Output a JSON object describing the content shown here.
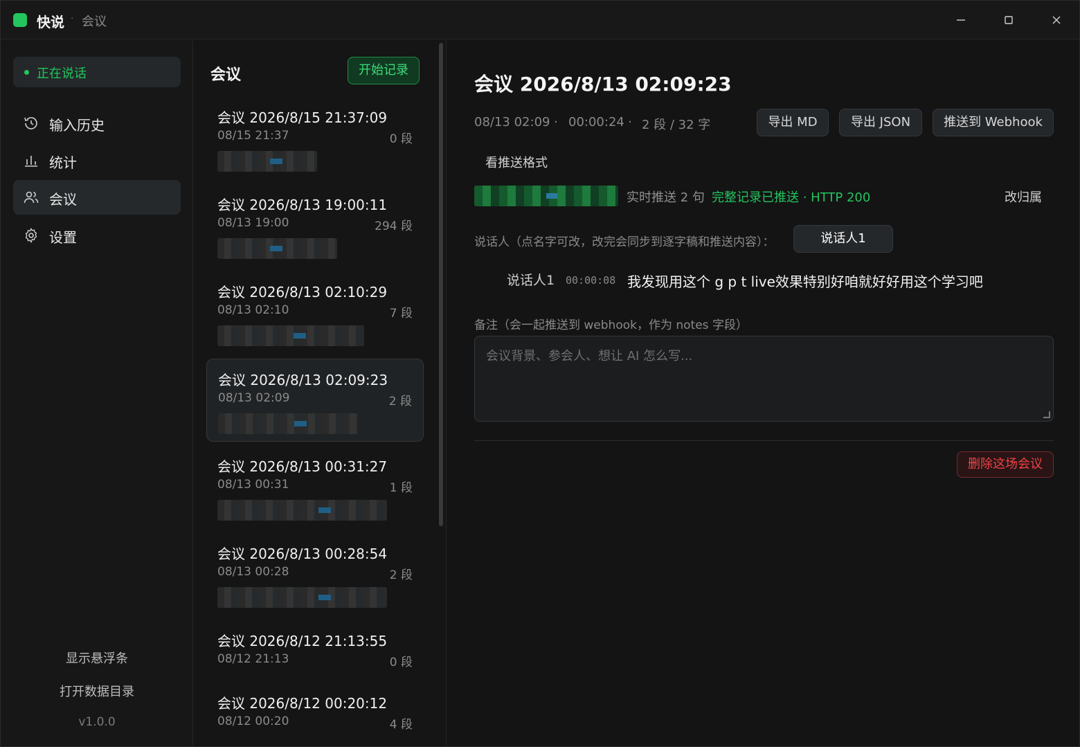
{
  "titlebar": {
    "app_name": "快说",
    "separator": "·",
    "section": "会议",
    "minimize_symbol": "—",
    "maximize_symbol": "☐",
    "close_symbol": "✕"
  },
  "sidebar": {
    "live_status": "正在说话",
    "items": [
      {
        "label": "输入历史",
        "icon": "history-icon"
      },
      {
        "label": "统计",
        "icon": "bar-chart-icon"
      },
      {
        "label": "会议",
        "icon": "users-icon",
        "active": true
      },
      {
        "label": "设置",
        "icon": "gear-icon"
      }
    ],
    "show_floating_bar": "显示悬浮条",
    "open_data_dir": "打开数据目录",
    "version": "v1.0.0"
  },
  "list": {
    "title": "会议",
    "start_button": "开始记录",
    "meetings": [
      {
        "title": "会议 2026/8/15 21:37:09",
        "date": "08/15 21:37",
        "count": "0 段"
      },
      {
        "title": "会议 2026/8/13 19:00:11",
        "date": "08/13 19:00",
        "count": "294 段"
      },
      {
        "title": "会议 2026/8/13 02:10:29",
        "date": "08/13 02:10",
        "count": "7 段"
      },
      {
        "title": "会议 2026/8/13 02:09:23",
        "date": "08/13 02:09",
        "count": "2 段",
        "selected": true
      },
      {
        "title": "会议 2026/8/13 00:31:27",
        "date": "08/13 00:31",
        "count": "1 段"
      },
      {
        "title": "会议 2026/8/13 00:28:54",
        "date": "08/13 00:28",
        "count": "2 段"
      },
      {
        "title": "会议 2026/8/12 21:13:55",
        "date": "08/12 21:13",
        "count": "0 段"
      },
      {
        "title": "会议 2026/8/12 00:20:12",
        "date": "08/12 00:20",
        "count": "4 段"
      }
    ]
  },
  "detail": {
    "title": "会议 2026/8/13 02:09:23",
    "meta_date": "08/13 02:09",
    "meta_sep1": "·",
    "meta_duration": "00:00:24",
    "meta_sep2": "·",
    "meta_stats": "2 段 / 32 字",
    "export_md": "导出 MD",
    "export_json": "导出 JSON",
    "push_webhook": "推送到 Webhook",
    "view_format": "看推送格式",
    "realtime_push": "实时推送 2 句",
    "push_status": "完整记录已推送 · HTTP 200",
    "reassign": "改归属",
    "speaker_label": "说话人（点名字可改，改完会同步到逐字稿和推送内容）：",
    "speaker_chip": "说话人1",
    "segment": {
      "speaker": "说话人1",
      "time": "00:00:08",
      "text": "我发现用这个 g p t live效果特别好咱就好好用这个学习吧"
    },
    "notes_label": "备注（会一起推送到 webhook，作为 notes 字段）",
    "notes_placeholder": "会议背景、参会人、想让 AI 怎么写...",
    "delete_button": "删除这场会议"
  },
  "colors": {
    "accent": "#22c55e",
    "danger": "#ef4444",
    "background": "#141414"
  }
}
